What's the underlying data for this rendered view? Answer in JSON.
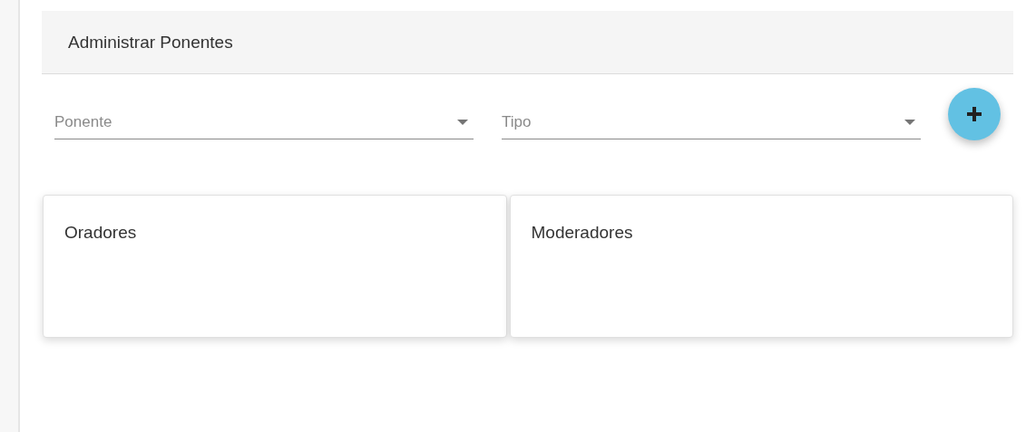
{
  "header": {
    "title": "Administrar Ponentes"
  },
  "selects": [
    {
      "placeholder": "Ponente"
    },
    {
      "placeholder": "Tipo"
    }
  ],
  "cards": [
    {
      "title": "Oradores"
    },
    {
      "title": "Moderadores"
    }
  ]
}
